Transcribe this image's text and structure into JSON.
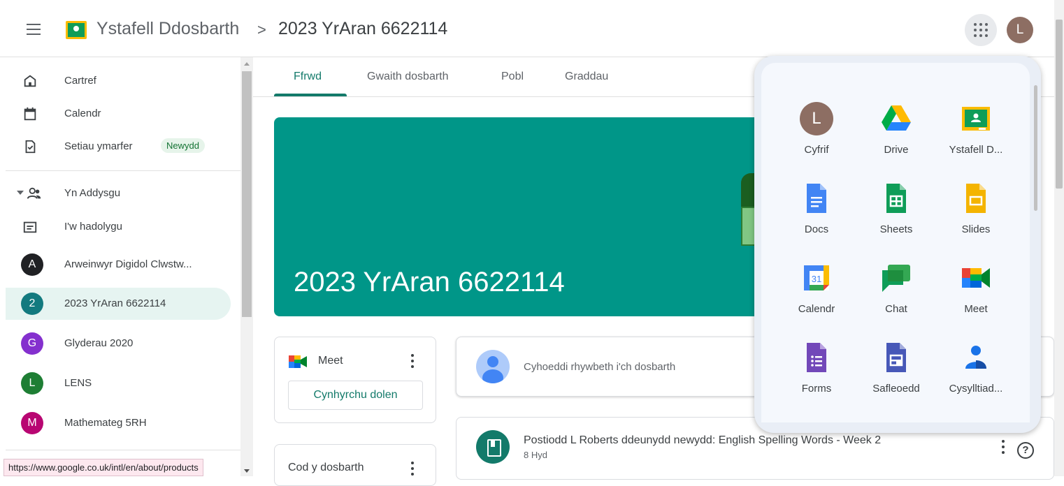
{
  "header": {
    "app_title": "Ystafell Ddosbarth",
    "separator": ">",
    "class_name": "2023 YrAran 6622114",
    "account_initial": "L"
  },
  "sidebar": {
    "items": [
      {
        "label": "Cartref",
        "icon": "home-icon"
      },
      {
        "label": "Calendr",
        "icon": "calendar-icon"
      },
      {
        "label": "Setiau ymarfer",
        "icon": "practice-sets-icon",
        "badge": "Newydd"
      },
      {
        "label": "Yn Addysgu",
        "icon": "teaching-icon"
      },
      {
        "label": "I'w hadolygu",
        "icon": "review-folder-icon"
      },
      {
        "label": "Arweinwyr Digidol Clwstw...",
        "initial": "A",
        "color": "#202124"
      },
      {
        "label": "2023 YrAran 6622114",
        "initial": "2",
        "color": "#137a7f"
      },
      {
        "label": "Glyderau 2020",
        "initial": "G",
        "color": "#8430ce"
      },
      {
        "label": "LENS",
        "initial": "L",
        "color": "#1e7e34"
      },
      {
        "label": "Mathemateg 5RH",
        "initial": "M",
        "color": "#b80672"
      }
    ]
  },
  "status_url": "https://www.google.co.uk/intl/en/about/products",
  "tabs": [
    "Ffrwd",
    "Gwaith dosbarth",
    "Pobl",
    "Graddau"
  ],
  "banner": {
    "title": "2023 YrAran 6622114",
    "color": "#009688"
  },
  "meet_card": {
    "label": "Meet",
    "button": "Cynhyrchu dolen"
  },
  "code_card": {
    "label": "Cod y dosbarth"
  },
  "announce": {
    "placeholder": "Cyhoeddi rhywbeth i'ch dosbarth"
  },
  "post": {
    "title": "Postiodd L Roberts ddeunydd newydd: English Spelling Words - Week 2",
    "date": "8 Hyd"
  },
  "help_glyph": "?",
  "apps": [
    {
      "label": "Cyfrif",
      "icon": "account-icon",
      "initial": "L"
    },
    {
      "label": "Drive",
      "icon": "drive-icon"
    },
    {
      "label": "Ystafell D...",
      "icon": "classroom-icon"
    },
    {
      "label": "Docs",
      "icon": "docs-icon"
    },
    {
      "label": "Sheets",
      "icon": "sheets-icon"
    },
    {
      "label": "Slides",
      "icon": "slides-icon"
    },
    {
      "label": "Calendr",
      "icon": "calendar-app-icon",
      "day": "31"
    },
    {
      "label": "Chat",
      "icon": "chat-icon"
    },
    {
      "label": "Meet",
      "icon": "meet-icon"
    },
    {
      "label": "Forms",
      "icon": "forms-icon"
    },
    {
      "label": "Safleoedd",
      "icon": "sites-icon"
    },
    {
      "label": "Cysylltiad...",
      "icon": "contacts-icon"
    }
  ],
  "colors": {
    "accent": "#137a6a",
    "active_nav": "#e6f4f1",
    "panel_bg": "#e9eef6"
  }
}
